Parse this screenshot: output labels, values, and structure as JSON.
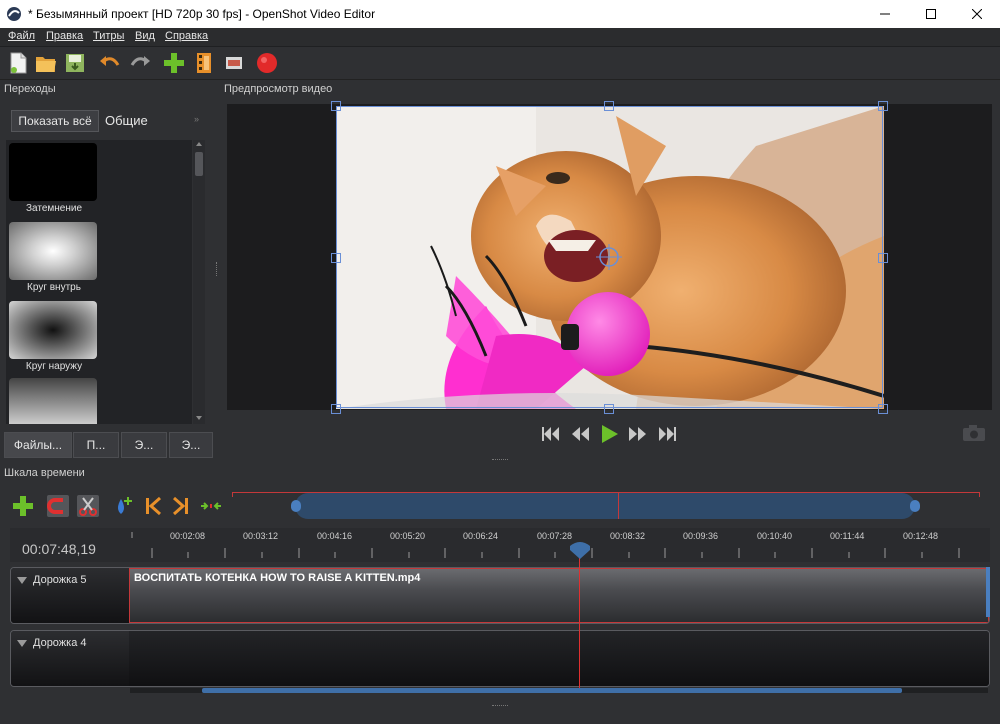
{
  "window": {
    "title": "* Безымянный проект [HD 720p 30 fps] - OpenShot Video Editor",
    "app_icon": "openshot-logo-icon",
    "controls": [
      "minimize-icon",
      "maximize-icon",
      "close-icon"
    ]
  },
  "menu": {
    "items": [
      "Файл",
      "Правка",
      "Титры",
      "Вид",
      "Справка"
    ]
  },
  "toolbar": {
    "icons": [
      "new-project-icon",
      "open-project-icon",
      "save-project-icon",
      "undo-icon",
      "redo-icon",
      "import-files-icon",
      "choose-profile-icon",
      "fullscreen-icon",
      "export-video-icon"
    ]
  },
  "transitions": {
    "title": "Переходы",
    "filter_show_all": "Показать всё",
    "filter_common": "Общие",
    "items": [
      {
        "label": "Затемнение"
      },
      {
        "label": "Круг внутрь"
      },
      {
        "label": "Круг наружу"
      }
    ]
  },
  "tabs": [
    "Файлы...",
    "П...",
    "Э...",
    "Э..."
  ],
  "preview": {
    "title": "Предпросмотр видео",
    "controls": [
      "jump-start-icon",
      "rewind-icon",
      "play-icon",
      "fast-forward-icon",
      "jump-end-icon"
    ],
    "snapshot": "camera-icon"
  },
  "timeline": {
    "title": "Шкала времени",
    "current_time": "00:07:48,19",
    "tools": [
      "add-track-icon",
      "snapping-icon",
      "razor-icon",
      "add-marker-icon",
      "previous-marker-icon",
      "next-marker-icon",
      "center-playhead-icon"
    ],
    "ticks": [
      "00:02:08",
      "00:03:12",
      "00:04:16",
      "00:05:20",
      "00:06:24",
      "00:07:28",
      "00:08:32",
      "00:09:36",
      "00:10:40",
      "00:11:44",
      "00:12:48"
    ],
    "tracks": [
      {
        "name": "Дорожка 5",
        "clip": "ВОСПИТАТЬ КОТЕНКА HOW TO RAISE A KITTEN.mp4"
      },
      {
        "name": "Дорожка 4",
        "clip": ""
      }
    ]
  },
  "colors": {
    "accent_red": "#c4383a",
    "play_green": "#6cc02a",
    "handle_blue": "#6a8fd6",
    "ball_pink": "#ff2fd0"
  }
}
